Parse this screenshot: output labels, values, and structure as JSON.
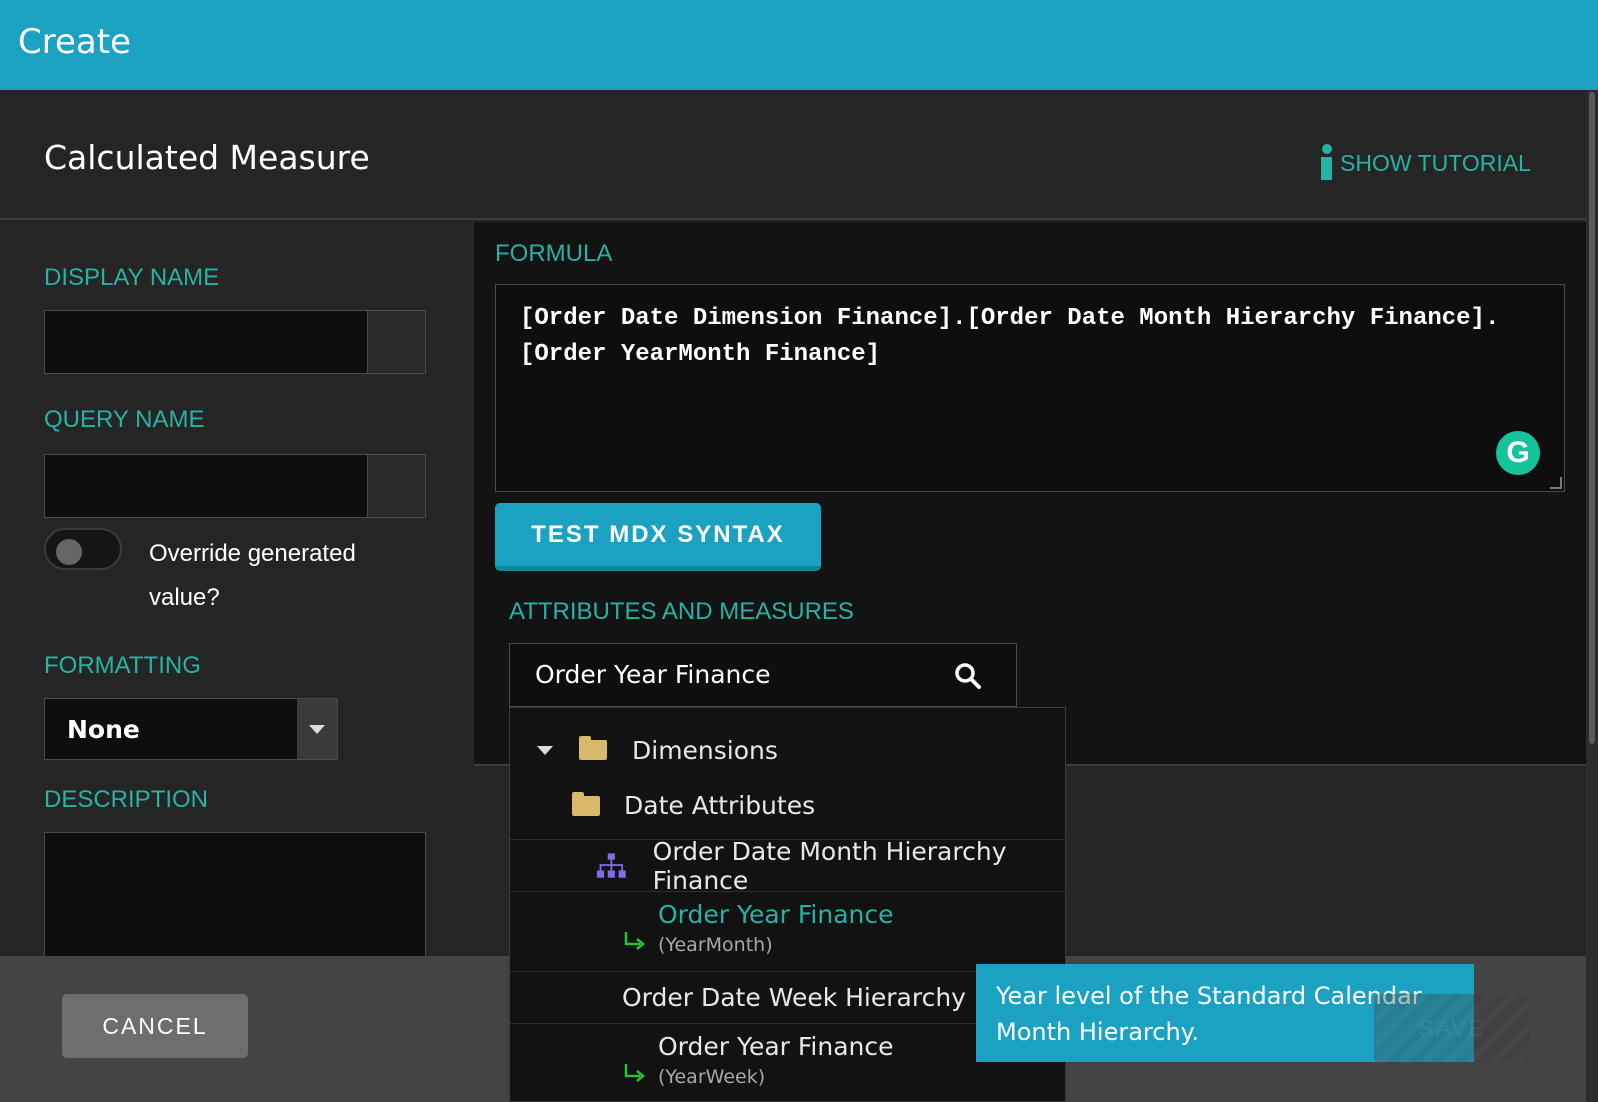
{
  "topbar": {
    "title": "Create"
  },
  "dialog": {
    "title": "Calculated Measure",
    "tutorial_label": "SHOW TUTORIAL"
  },
  "left": {
    "display_name_label": "DISPLAY NAME",
    "display_name_value": "",
    "query_name_label": "QUERY NAME",
    "query_name_value": "",
    "override_label": "Override generated value?",
    "formatting_label": "FORMATTING",
    "formatting_value": "None",
    "description_label": "DESCRIPTION"
  },
  "formula": {
    "label": "FORMULA",
    "text": "[Order Date Dimension Finance].[Order Date Month Hierarchy Finance].[Order YearMonth Finance]",
    "test_button": "TEST MDX SYNTAX"
  },
  "attributes": {
    "label": "ATTRIBUTES AND MEASURES",
    "search_value": "Order Year Finance",
    "tree": {
      "dimensions": "Dimensions",
      "date_attributes": "Date Attributes",
      "hierarchy_1": "Order Date Month Hierarchy Finance",
      "level_1": "Order Year Finance",
      "level_1_sub": "(YearMonth)",
      "hierarchy_2": "Order Date Week Hierarchy Finance",
      "level_2": "Order Year Finance",
      "level_2_sub": "(YearWeek)"
    }
  },
  "tooltip": {
    "text": "Year level of the Standard Calendar Month Hierarchy."
  },
  "footer": {
    "cancel": "CANCEL",
    "save": "SAVE"
  },
  "colors": {
    "accent": "#1ba2c2",
    "teal": "#27b3a4",
    "hierarchy": "#7b6ee6",
    "folder": "#d8b86a"
  }
}
